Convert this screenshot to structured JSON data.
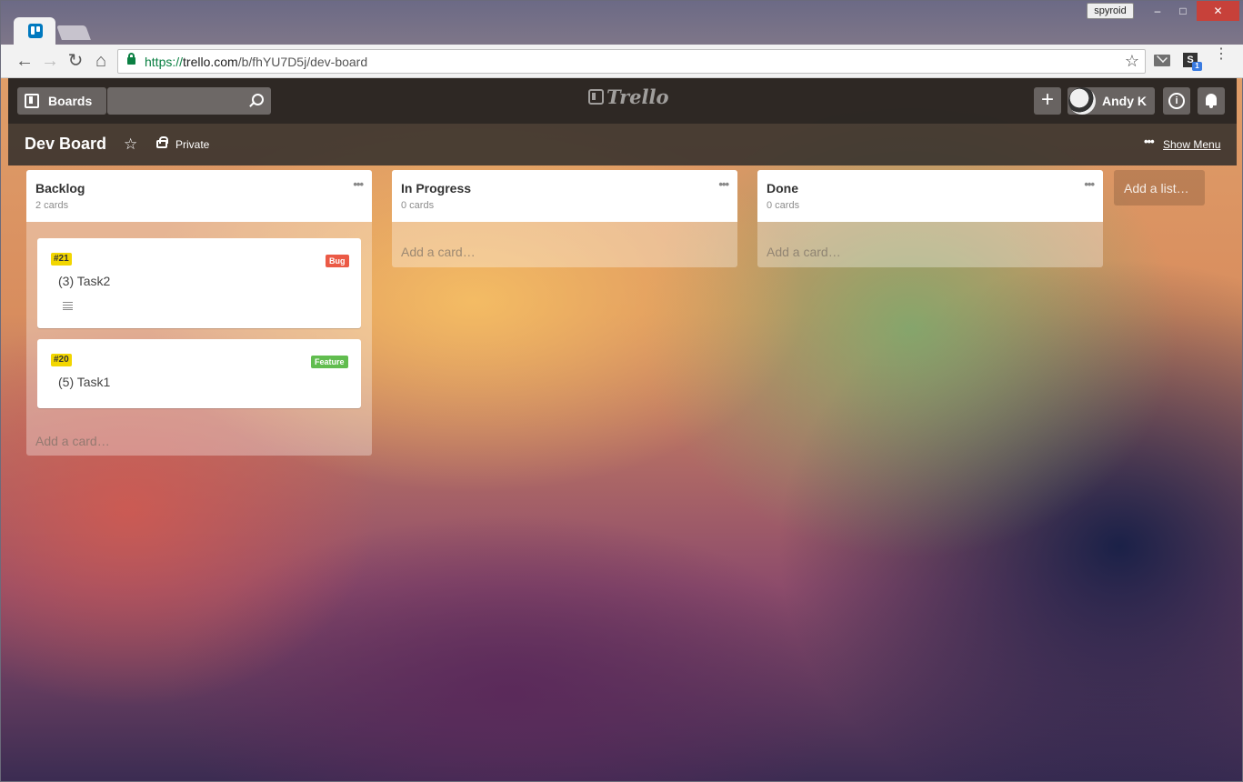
{
  "browser": {
    "user_badge": "spyroid",
    "url_scheme": "https://",
    "url_host": "trello.com",
    "url_path": "/b/fhYU7D5j/dev-board",
    "extension_badge": "1",
    "extension_letter": "S"
  },
  "header": {
    "boards_label": "Boards",
    "logo_text": "Trello",
    "member_name": "Andy K",
    "add_label": "+",
    "info_label": "i"
  },
  "board": {
    "title": "Dev Board",
    "visibility": "Private",
    "show_menu": "Show Menu"
  },
  "lists": [
    {
      "title": "Backlog",
      "count": "2 cards",
      "add_card": "Add a card…",
      "cards": [
        {
          "number": "#21",
          "title": "(3) Task2",
          "label": "Bug",
          "label_color": "#eb5a46",
          "has_description": true
        },
        {
          "number": "#20",
          "title": "(5) Task1",
          "label": "Feature",
          "label_color": "#61bd4f",
          "has_description": false
        }
      ]
    },
    {
      "title": "In Progress",
      "count": "0 cards",
      "add_card": "Add a card…",
      "cards": []
    },
    {
      "title": "Done",
      "count": "0 cards",
      "add_card": "Add a card…",
      "cards": []
    }
  ],
  "add_list": "Add a list…",
  "colors": {
    "trello_blue": "#0079bf",
    "number_label": "#f2d600",
    "bug_label": "#eb5a46",
    "feature_label": "#61bd4f"
  }
}
